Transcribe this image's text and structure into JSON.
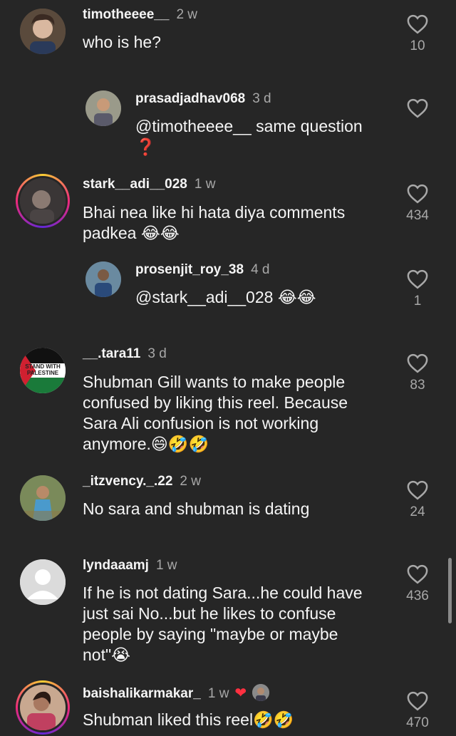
{
  "comments": [
    {
      "user": "timotheeee__",
      "time": "2 w",
      "text": "who is he?",
      "likes": "10"
    },
    {
      "user": "prasadjadhav068",
      "time": "3 d",
      "text": "@timotheeee__ same question",
      "emoji": "❓",
      "likes": ""
    },
    {
      "user": "stark__adi__028",
      "time": "1 w",
      "text": "Bhai nea like hi hata diya comments padkea 😂😂",
      "likes": "434"
    },
    {
      "user": "prosenjit_roy_38",
      "time": "4 d",
      "text": "@stark__adi__028 😂😂",
      "likes": "1"
    },
    {
      "user": "__.tara11",
      "time": "3 d",
      "text": "Shubman Gill wants to make people confused by liking this reel. Because Sara Ali confusion is not working anymore.😄🤣🤣",
      "likes": "83",
      "avatar_text": "STAND WITH PALESTINE"
    },
    {
      "user": "_itzvency._.22",
      "time": "2 w",
      "text": "No sara and shubman is dating",
      "likes": "24"
    },
    {
      "user": "lyndaaamj",
      "time": "1 w",
      "text": "If he is not dating Sara...he could have just sai No...but he likes to confuse people by saying \"maybe or maybe not\"😭",
      "likes": "436"
    },
    {
      "user": "baishalikarmakar_",
      "time": "1 w",
      "text": "Shubman liked this reel🤣🤣",
      "likes": "470"
    }
  ],
  "icons": {
    "like": "heart-outline-icon",
    "creator_like": "red-heart-icon"
  },
  "colors": {
    "background": "#262626",
    "secondary_text": "#a8a8a8",
    "creator_heart": "#ff3040"
  }
}
